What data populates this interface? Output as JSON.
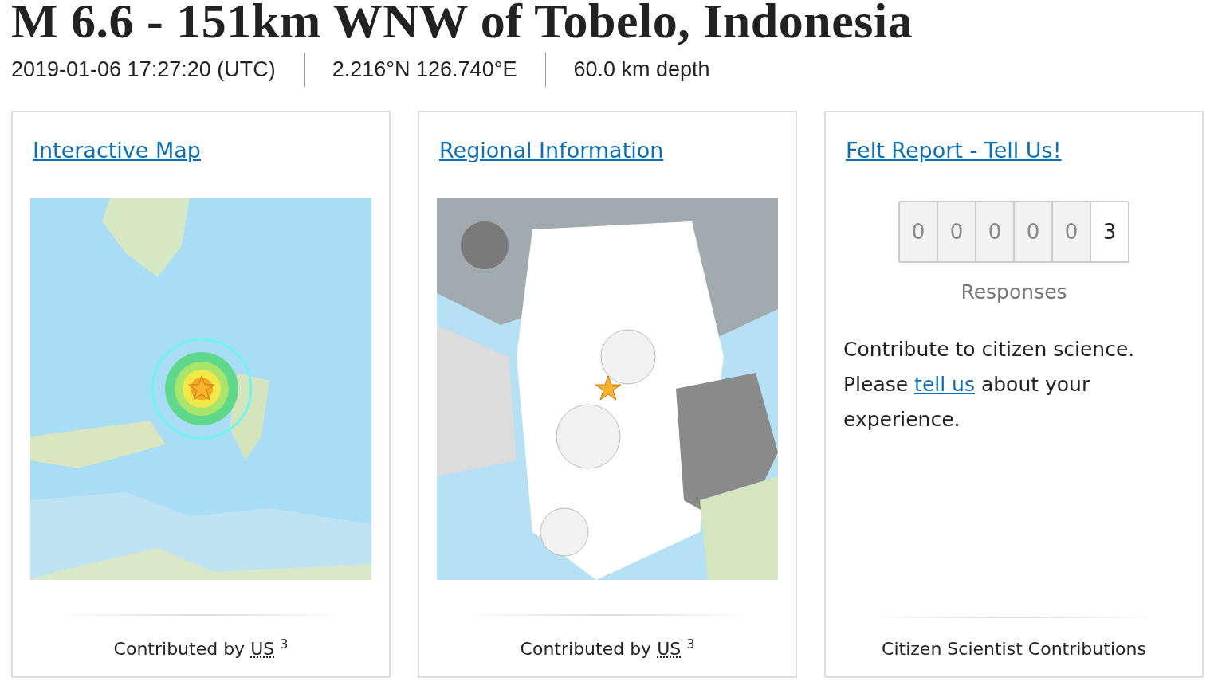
{
  "title": "M 6.6 - 151km WNW of Tobelo, Indonesia",
  "meta": [
    "2019-01-06 17:27:20 (UTC)",
    "2.216°N 126.740°E",
    "60.0 km depth"
  ],
  "cards": [
    {
      "kind": "map",
      "link": "Interactive Map",
      "footer": {
        "text": "Contributed by",
        "source": "US",
        "count": "3"
      }
    },
    {
      "kind": "regional",
      "link": "Regional Information",
      "footer": {
        "text": "Contributed by",
        "source": "US",
        "count": "3"
      }
    },
    {
      "kind": "felt",
      "link": "Felt Report - Tell Us!",
      "digits": [
        {
          "value": "0",
          "leading": true
        },
        {
          "value": "0",
          "leading": true
        },
        {
          "value": "0",
          "leading": true
        },
        {
          "value": "0",
          "leading": true
        },
        {
          "value": "0",
          "leading": true
        },
        {
          "value": "3",
          "leading": false
        }
      ],
      "caption": "Responses",
      "paragraph": [
        "Contribute to citizen science.",
        "Please",
        "tell us",
        "about your experience."
      ],
      "footer": {
        "text": "Citizen Scientist Contributions"
      }
    }
  ]
}
